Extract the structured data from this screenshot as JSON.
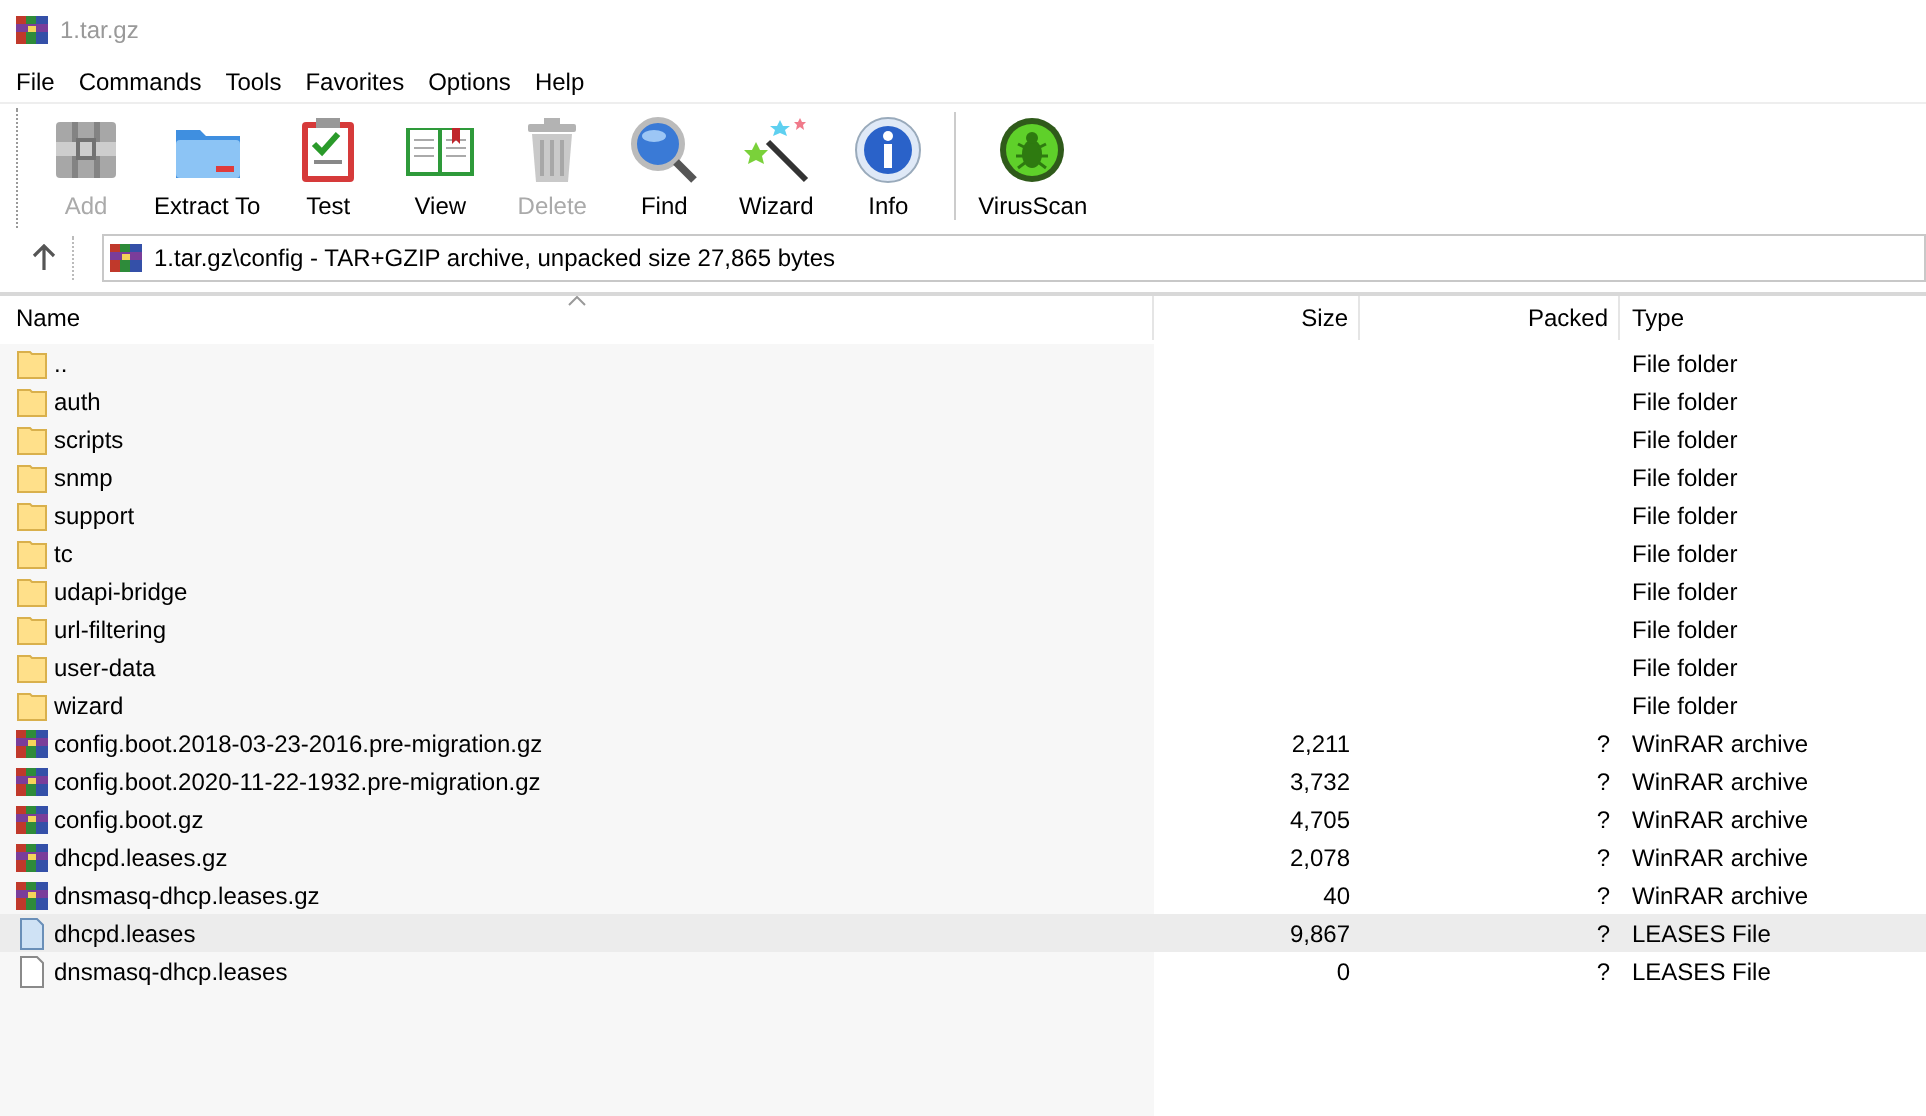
{
  "window": {
    "title": "1.tar.gz"
  },
  "menu": [
    "File",
    "Commands",
    "Tools",
    "Favorites",
    "Options",
    "Help"
  ],
  "toolbar_groups": [
    {
      "buttons": [
        {
          "label": "Add",
          "kind": "add",
          "disabled": true
        },
        {
          "label": "Extract To",
          "kind": "extract",
          "disabled": false
        },
        {
          "label": "Test",
          "kind": "test",
          "disabled": false
        },
        {
          "label": "View",
          "kind": "view",
          "disabled": false
        },
        {
          "label": "Delete",
          "kind": "delete",
          "disabled": true
        },
        {
          "label": "Find",
          "kind": "find",
          "disabled": false
        },
        {
          "label": "Wizard",
          "kind": "wizard",
          "disabled": false
        },
        {
          "label": "Info",
          "kind": "info",
          "disabled": false
        }
      ]
    },
    {
      "buttons": [
        {
          "label": "VirusScan",
          "kind": "virusscan",
          "disabled": false
        }
      ]
    }
  ],
  "address": {
    "path": "1.tar.gz\\config - TAR+GZIP archive, unpacked size 27,865 bytes"
  },
  "table": {
    "columns": [
      {
        "label": "Name",
        "sorted": true
      },
      {
        "label": "Size",
        "sorted": false
      },
      {
        "label": "Packed",
        "sorted": false
      },
      {
        "label": "Type",
        "sorted": false
      }
    ],
    "rows": [
      {
        "kind": "folder",
        "name": "..",
        "type": "File folder",
        "selected": false
      },
      {
        "kind": "folder",
        "name": "auth",
        "type": "File folder",
        "selected": false
      },
      {
        "kind": "folder",
        "name": "scripts",
        "type": "File folder",
        "selected": false
      },
      {
        "kind": "folder",
        "name": "snmp",
        "type": "File folder",
        "selected": false
      },
      {
        "kind": "folder",
        "name": "support",
        "type": "File folder",
        "selected": false
      },
      {
        "kind": "folder",
        "name": "tc",
        "type": "File folder",
        "selected": false
      },
      {
        "kind": "folder",
        "name": "udapi-bridge",
        "type": "File folder",
        "selected": false
      },
      {
        "kind": "folder",
        "name": "url-filtering",
        "type": "File folder",
        "selected": false
      },
      {
        "kind": "folder",
        "name": "user-data",
        "type": "File folder",
        "selected": false
      },
      {
        "kind": "folder",
        "name": "wizard",
        "type": "File folder",
        "selected": false
      },
      {
        "kind": "archive",
        "name": "config.boot.2018-03-23-2016.pre-migration.gz",
        "size": "2,211",
        "packed": "?",
        "type": "WinRAR archive",
        "selected": false
      },
      {
        "kind": "archive",
        "name": "config.boot.2020-11-22-1932.pre-migration.gz",
        "size": "3,732",
        "packed": "?",
        "type": "WinRAR archive",
        "selected": false
      },
      {
        "kind": "archive",
        "name": "config.boot.gz",
        "size": "4,705",
        "packed": "?",
        "type": "WinRAR archive",
        "selected": false
      },
      {
        "kind": "archive",
        "name": "dhcpd.leases.gz",
        "size": "2,078",
        "packed": "?",
        "type": "WinRAR archive",
        "selected": false
      },
      {
        "kind": "archive",
        "name": "dnsmasq-dhcp.leases.gz",
        "size": "40",
        "packed": "?",
        "type": "WinRAR archive",
        "selected": false
      },
      {
        "kind": "document-blue",
        "name": "dhcpd.leases",
        "size": "9,867",
        "packed": "?",
        "type": "LEASES File",
        "selected": true
      },
      {
        "kind": "document",
        "name": "dnsmasq-dhcp.leases",
        "size": "0",
        "packed": "?",
        "type": "LEASES File",
        "selected": false
      }
    ]
  }
}
